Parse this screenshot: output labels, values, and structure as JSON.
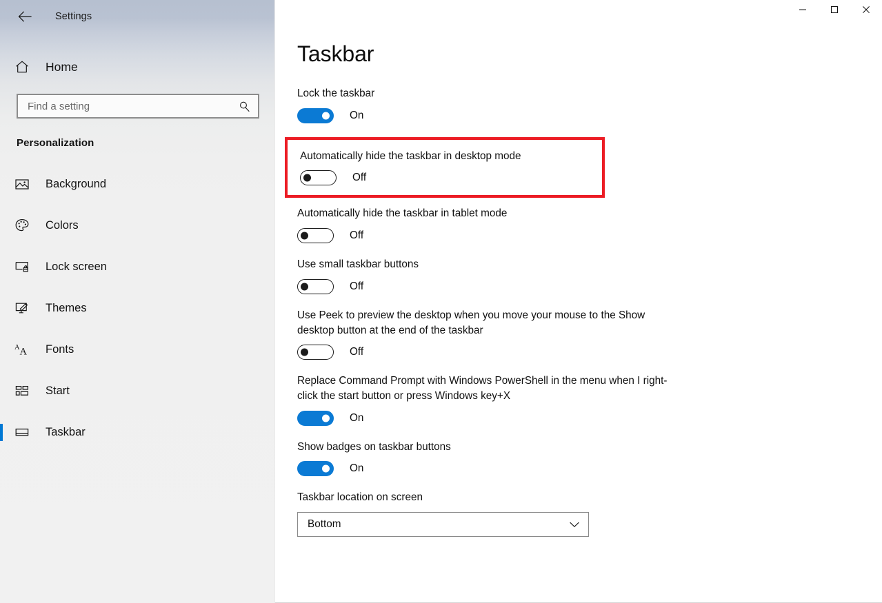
{
  "window": {
    "app_title": "Settings",
    "back_icon": "back-arrow-icon",
    "controls": {
      "minimize": "minimize-icon",
      "maximize": "maximize-icon",
      "close": "close-icon"
    }
  },
  "sidebar": {
    "home": {
      "label": "Home",
      "icon": "home-icon"
    },
    "search": {
      "placeholder": "Find a setting",
      "value": "",
      "icon": "search-icon"
    },
    "section_title": "Personalization",
    "items": [
      {
        "label": "Background",
        "icon": "image-icon",
        "selected": false
      },
      {
        "label": "Colors",
        "icon": "palette-icon",
        "selected": false
      },
      {
        "label": "Lock screen",
        "icon": "lock-screen-icon",
        "selected": false
      },
      {
        "label": "Themes",
        "icon": "brush-icon",
        "selected": false
      },
      {
        "label": "Fonts",
        "icon": "fonts-aa-icon",
        "selected": false
      },
      {
        "label": "Start",
        "icon": "start-tiles-icon",
        "selected": false
      },
      {
        "label": "Taskbar",
        "icon": "taskbar-icon",
        "selected": true
      }
    ]
  },
  "main": {
    "page_title": "Taskbar",
    "settings": [
      {
        "label": "Lock the taskbar",
        "state": "On",
        "on": true,
        "highlighted": false
      },
      {
        "label": "Automatically hide the taskbar in desktop mode",
        "state": "Off",
        "on": false,
        "highlighted": true
      },
      {
        "label": "Automatically hide the taskbar in tablet mode",
        "state": "Off",
        "on": false,
        "highlighted": false
      },
      {
        "label": "Use small taskbar buttons",
        "state": "Off",
        "on": false,
        "highlighted": false
      },
      {
        "label": "Use Peek to preview the desktop when you move your mouse to the Show desktop button at the end of the taskbar",
        "state": "Off",
        "on": false,
        "highlighted": false
      },
      {
        "label": "Replace Command Prompt with Windows PowerShell in the menu when I right-click the start button or press Windows key+X",
        "state": "On",
        "on": true,
        "highlighted": false
      },
      {
        "label": "Show badges on taskbar buttons",
        "state": "On",
        "on": true,
        "highlighted": false
      }
    ],
    "location_setting": {
      "label": "Taskbar location on screen",
      "value": "Bottom",
      "chevron_icon": "chevron-down-icon"
    }
  },
  "colors": {
    "accent": "#0078d4",
    "toggle_on": "#0b7ad4",
    "highlight_box": "#ec1c24",
    "text": "#111111"
  }
}
